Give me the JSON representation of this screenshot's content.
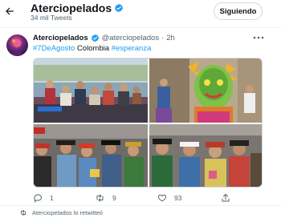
{
  "header": {
    "name": "Aterciopelados",
    "subtitle": "34 mil Tweets",
    "follow_label": "Siguiendo"
  },
  "tweet": {
    "name": "Aterciopelados",
    "handle": "@aterciopelados",
    "separator": "·",
    "time": "2h",
    "text": {
      "hashtag1": "#7DeAgosto",
      "word": " Colombia ",
      "hashtag2": "#esperanza"
    },
    "photos": [
      "photo-stage-group",
      "photo-costume-mask",
      "photo-crowd-hats",
      "photo-crowd-closeup"
    ],
    "actions": {
      "reply_count": "1",
      "retweet_count": "9",
      "like_count": "93",
      "share_count": ""
    }
  },
  "next": {
    "retweet_label": "Aterciopelados lo retwitteó"
  },
  "colors": {
    "accent": "#1d9bf0",
    "text": "#0f1419",
    "muted": "#536471",
    "border": "#cfd9de"
  },
  "icons": [
    "back-arrow-icon",
    "verified-badge-icon",
    "more-icon",
    "reply-icon",
    "retweet-icon",
    "like-icon",
    "share-icon"
  ]
}
